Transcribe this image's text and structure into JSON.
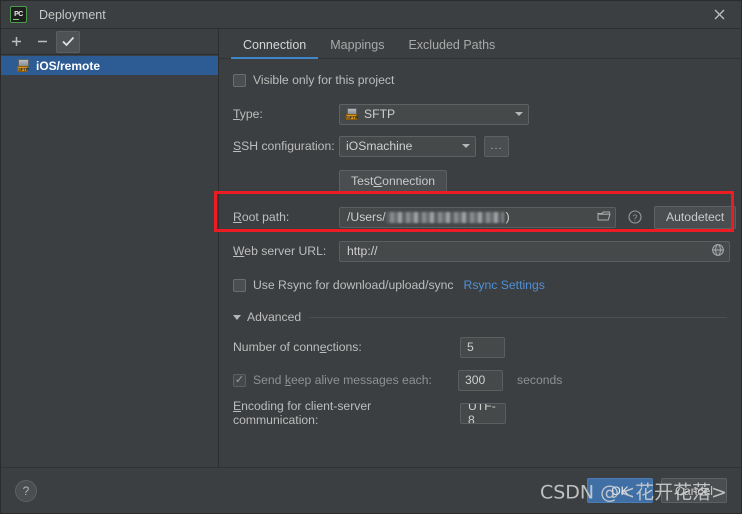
{
  "window": {
    "title": "Deployment",
    "app_icon": "pycharm-logo-icon",
    "close_label": "✕"
  },
  "sidebar": {
    "toolbar": {
      "add_label": "+",
      "remove_label": "−",
      "default_label": "✓"
    },
    "items": [
      {
        "label": "iOS/remote",
        "icon": "sftp-server-icon",
        "selected": true
      }
    ]
  },
  "tabs": [
    {
      "label": "Connection",
      "active": true
    },
    {
      "label": "Mappings",
      "active": false
    },
    {
      "label": "Excluded Paths",
      "active": false
    }
  ],
  "form": {
    "visible_only": {
      "label": "Visible only for this project",
      "checked": false
    },
    "type": {
      "label": "Type:",
      "mnemonic": "T",
      "value": "SFTP",
      "icon": "sftp-icon"
    },
    "ssh_configuration": {
      "label": "SSH configuration:",
      "mnemonic": "S",
      "value": "iOSmachine",
      "browse_label": "..."
    },
    "test_connection": {
      "label": "Test Connection",
      "mnemonic": "C"
    },
    "root_path": {
      "label": "Root path:",
      "mnemonic": "R",
      "value": "/Users/",
      "value_redacted": true,
      "value_suffix": ")",
      "browse_icon": "folder-icon",
      "help_icon": "help-icon",
      "autodetect_label": "Autodetect"
    },
    "web_server_url": {
      "label": "Web server URL:",
      "mnemonic": "W",
      "value": "http://",
      "open_icon": "globe-icon"
    },
    "use_rsync": {
      "label": "Use Rsync for download/upload/sync",
      "checked": false,
      "settings_link": "Rsync Settings"
    },
    "advanced": {
      "title": "Advanced",
      "expanded": true,
      "number_of_connections": {
        "label": "Number of connections:",
        "mnemonic": "e",
        "value": "5"
      },
      "keep_alive": {
        "label": "Send keep alive messages each:",
        "mnemonic": "k",
        "checked": true,
        "enabled": false,
        "value": "300",
        "units": "seconds"
      },
      "encoding": {
        "label": "Encoding for client-server communication:",
        "mnemonic": "E",
        "value": "UTF-8"
      }
    }
  },
  "annotation": {
    "color": "#ec1c24",
    "target": "root-path-row"
  },
  "footer": {
    "help_label": "?",
    "ok_label": "OK",
    "cancel_label": "Cancel"
  },
  "watermark": {
    "text": "CSDN @<花开花落>"
  }
}
